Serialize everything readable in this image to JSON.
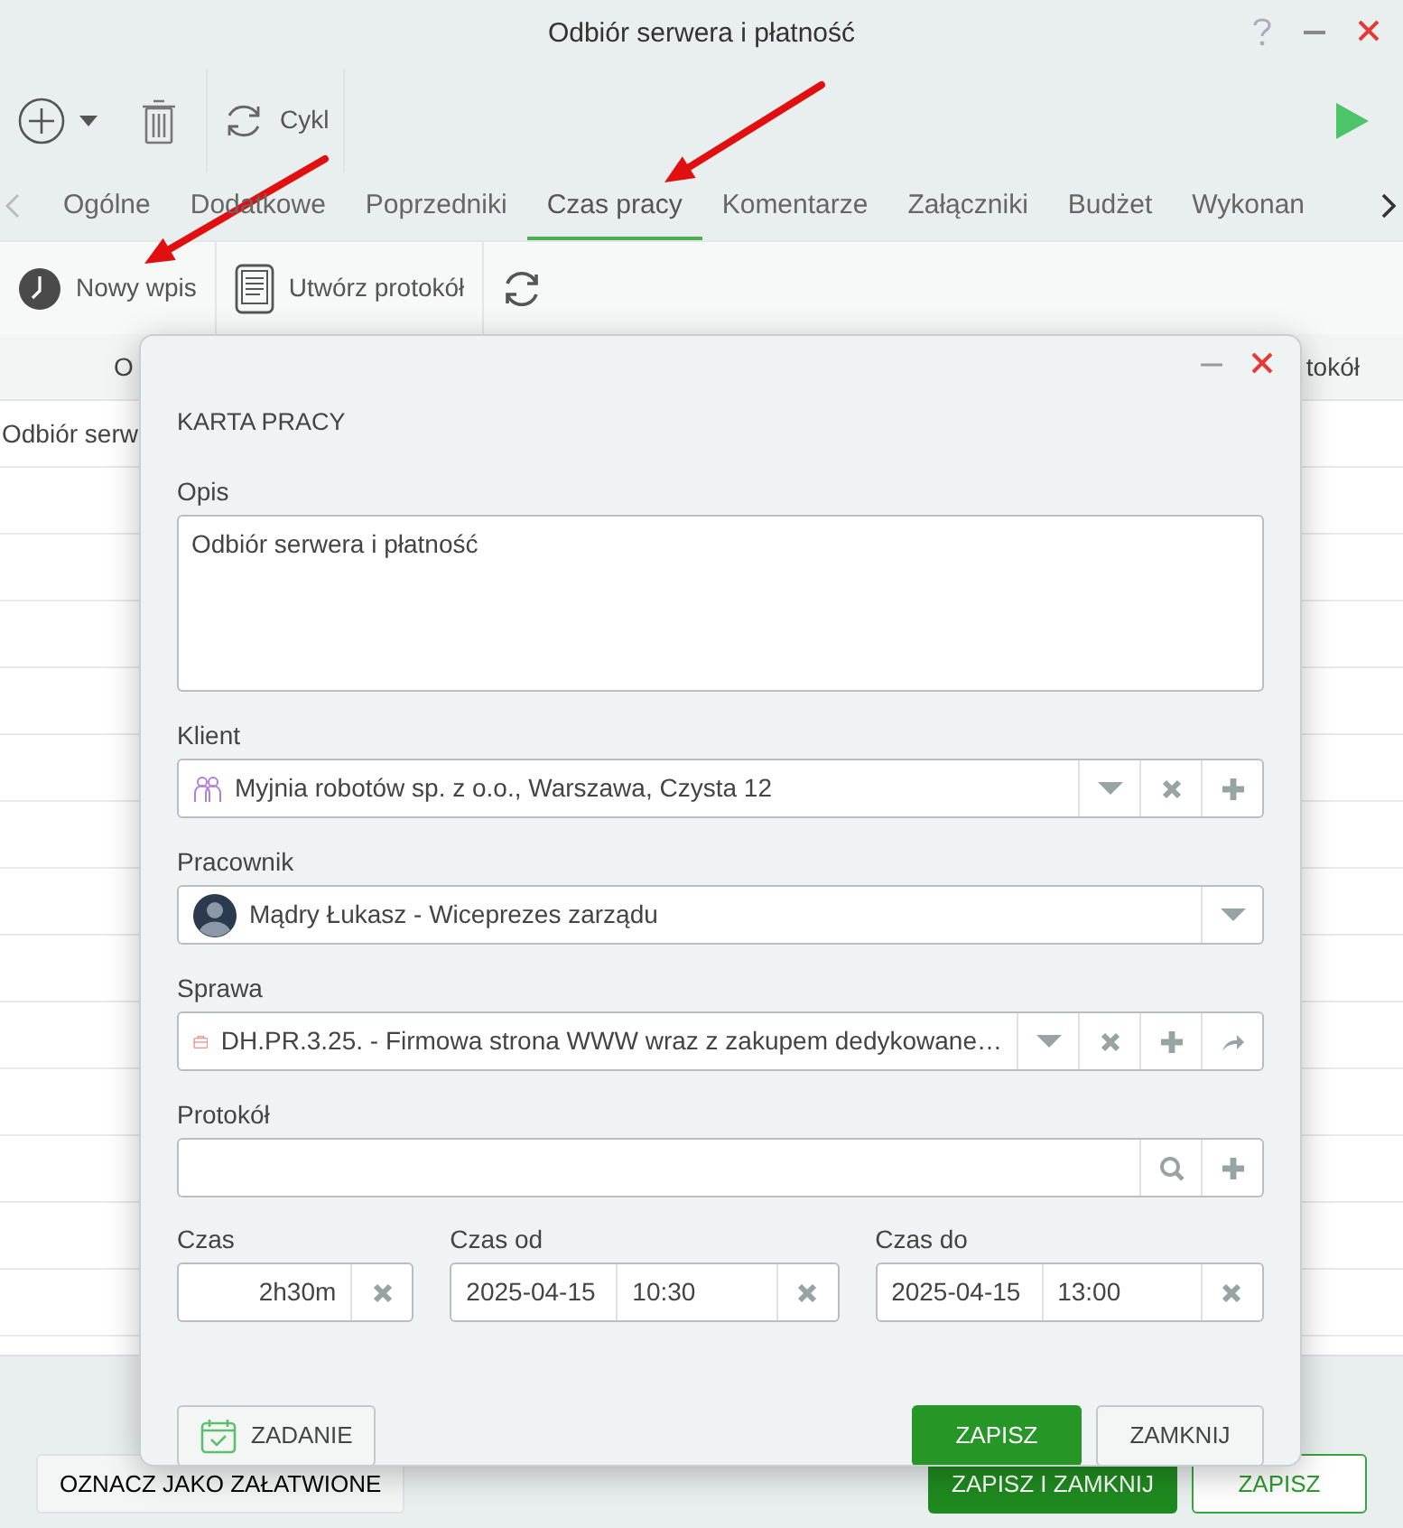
{
  "window": {
    "title": "Odbiór serwera i płatność"
  },
  "toolbar": {
    "cycle_label": "Cykl"
  },
  "tabs": [
    {
      "label": "Ogólne",
      "selected": false
    },
    {
      "label": "Dodatkowe",
      "selected": false
    },
    {
      "label": "Poprzedniki",
      "selected": false
    },
    {
      "label": "Czas pracy",
      "selected": true
    },
    {
      "label": "Komentarze",
      "selected": false
    },
    {
      "label": "Załączniki",
      "selected": false
    },
    {
      "label": "Budżet",
      "selected": false
    },
    {
      "label": "Wykonan",
      "selected": false
    }
  ],
  "subtoolbar": [
    {
      "kind": "new",
      "label": "Nowy wpis"
    },
    {
      "kind": "protocol",
      "label": "Utwórz protokół"
    },
    {
      "kind": "refresh"
    }
  ],
  "table": {
    "columns": [
      "O",
      "tokół"
    ],
    "rows": [
      [
        "Odbiór serw"
      ]
    ]
  },
  "dialog": {
    "title": "KARTA PRACY",
    "description": {
      "label": "Opis",
      "value": "Odbiór serwera i płatność"
    },
    "client": {
      "label": "Klient",
      "value": "Myjnia robotów sp. z o.o., Warszawa, Czysta 12"
    },
    "employee": {
      "label": "Pracownik",
      "value": "Mądry Łukasz - Wiceprezes zarządu"
    },
    "case": {
      "label": "Sprawa",
      "value": "DH.PR.3.25. - Firmowa strona WWW wraz z zakupem dedykowane…"
    },
    "protocol": {
      "label": "Protokół"
    },
    "duration": {
      "label": "Czas",
      "value": "2h30m"
    },
    "start": {
      "label": "Czas od",
      "date": "2025-04-15",
      "time": "10:30"
    },
    "end": {
      "label": "Czas do",
      "date": "2025-04-15",
      "time": "13:00"
    },
    "task_button": "ZADANIE",
    "save_button": "ZAPISZ",
    "close_button": "ZAMKNIJ"
  },
  "footer": {
    "resolve_button": "OZNACZ JAKO ZAŁATWIONE",
    "save_close_button": "ZAPISZ I ZAMKNIJ",
    "save_button": "ZAPISZ"
  }
}
